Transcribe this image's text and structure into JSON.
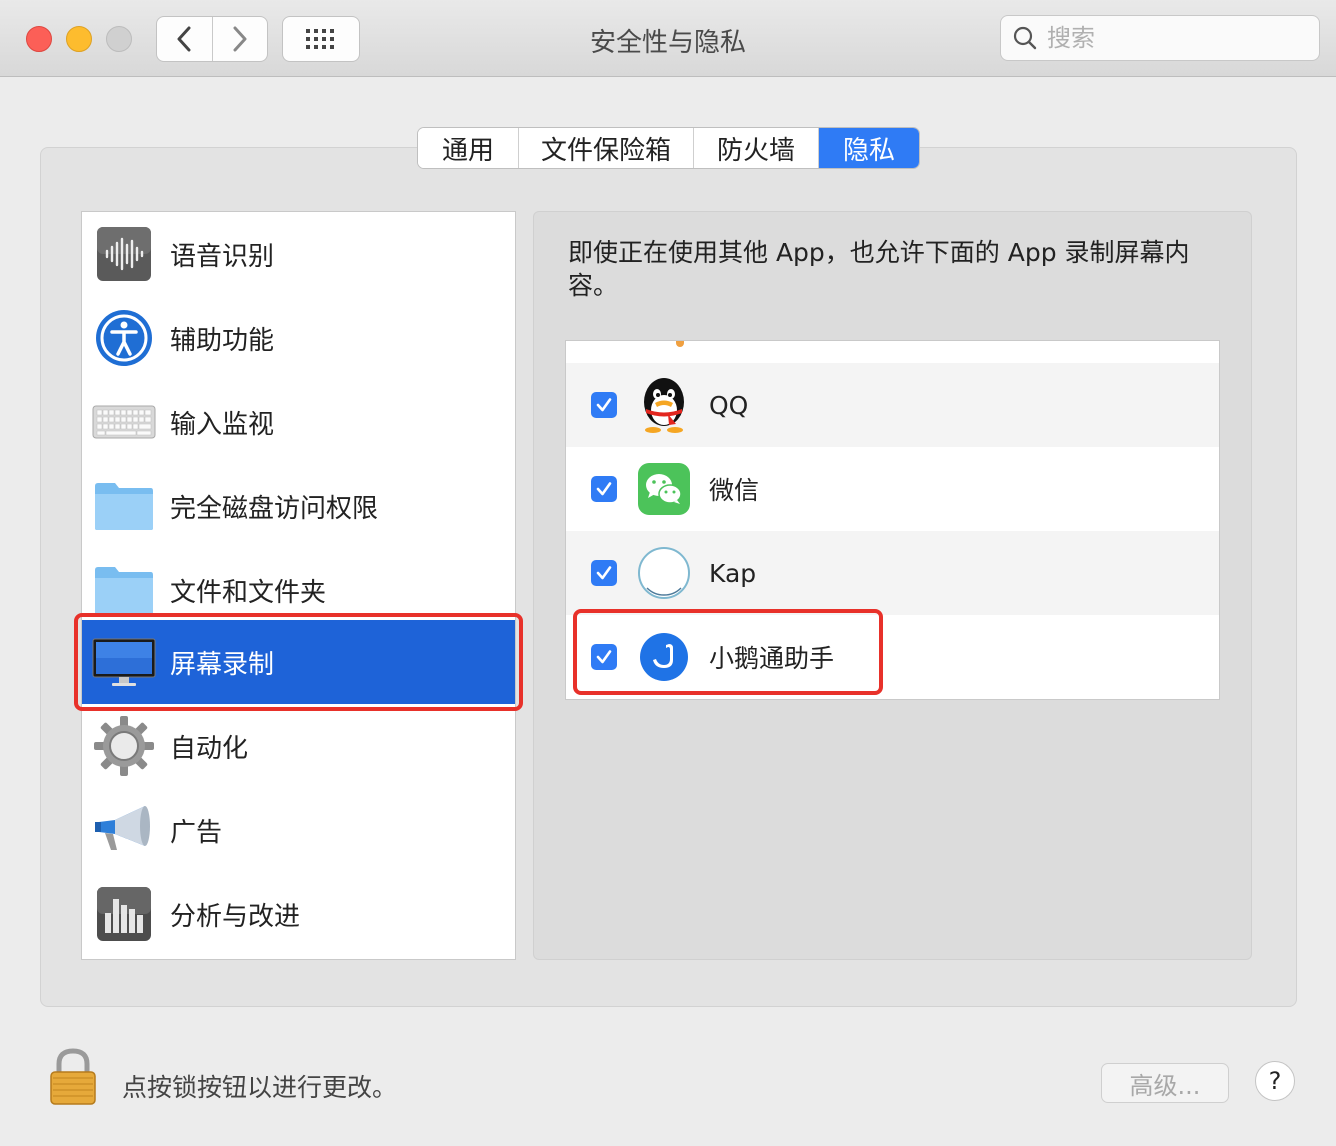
{
  "window": {
    "title": "安全性与隐私"
  },
  "toolbar": {
    "back_icon": "chevron-left-icon",
    "forward_icon": "chevron-right-icon",
    "grid_icon": "grid-icon"
  },
  "search": {
    "placeholder": "搜索"
  },
  "tabs": [
    {
      "label": "通用",
      "active": false
    },
    {
      "label": "文件保险箱",
      "active": false
    },
    {
      "label": "防火墙",
      "active": false
    },
    {
      "label": "隐私",
      "active": true
    }
  ],
  "sidebar": {
    "items": [
      {
        "label": "语音识别",
        "icon": "waveform-icon"
      },
      {
        "label": "辅助功能",
        "icon": "accessibility-icon"
      },
      {
        "label": "输入监视",
        "icon": "keyboard-icon"
      },
      {
        "label": "完全磁盘访问权限",
        "icon": "folder-icon"
      },
      {
        "label": "文件和文件夹",
        "icon": "folder-icon"
      },
      {
        "label": "屏幕录制",
        "icon": "display-icon",
        "selected": true
      },
      {
        "label": "自动化",
        "icon": "gear-icon"
      },
      {
        "label": "广告",
        "icon": "megaphone-icon"
      },
      {
        "label": "分析与改进",
        "icon": "bar-chart-icon"
      }
    ]
  },
  "main": {
    "description": "即使正在使用其他 App，也允许下面的 App 录制屏幕内容。",
    "apps": [
      {
        "name": "QQ",
        "checked": true,
        "icon": "qq-penguin-icon"
      },
      {
        "name": "微信",
        "checked": true,
        "icon": "wechat-icon"
      },
      {
        "name": "Kap",
        "checked": true,
        "icon": "kap-icon"
      },
      {
        "name": "小鹅通助手",
        "checked": true,
        "icon": "xiaoetong-goose-icon"
      }
    ]
  },
  "footer": {
    "lock_text": "点按锁按钮以进行更改。",
    "advanced_label": "高级...",
    "help_label": "?"
  },
  "colors": {
    "accent": "#2f7bf5",
    "selection": "#1e63d8",
    "highlight_box": "#e8312a"
  }
}
